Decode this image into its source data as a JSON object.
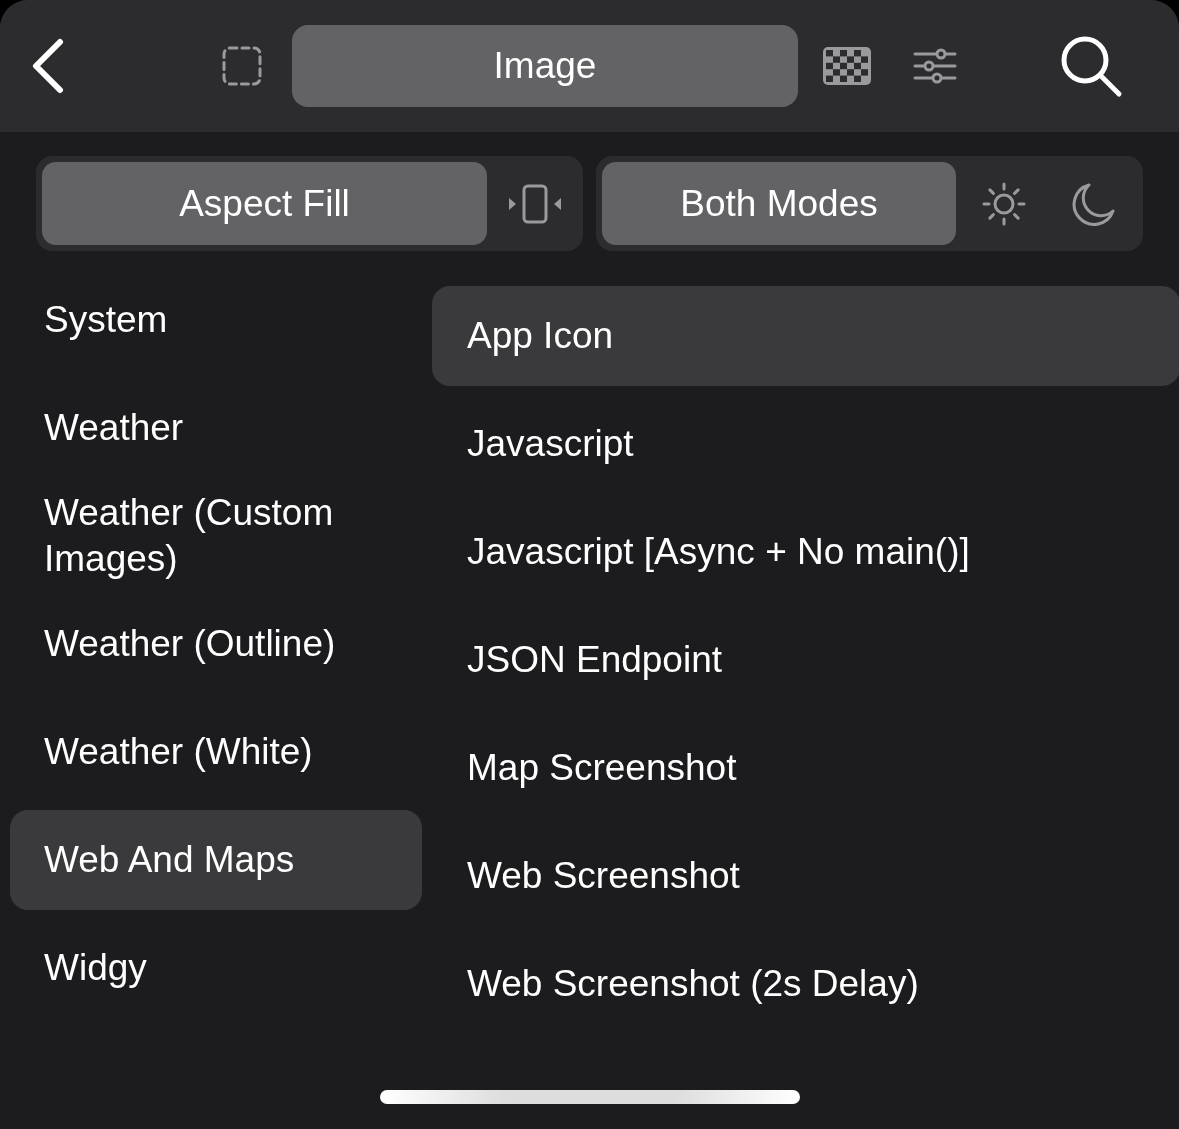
{
  "top_bar": {
    "title": "Image"
  },
  "segments": [
    {
      "label": "Aspect Fill",
      "selected": true
    },
    {
      "label": "Both Modes",
      "selected": true
    }
  ],
  "categories": [
    {
      "label": "System",
      "selected": false
    },
    {
      "label": "Weather",
      "selected": false
    },
    {
      "label": "Weather (Custom Images)",
      "selected": false
    },
    {
      "label": "Weather (Outline)",
      "selected": false
    },
    {
      "label": "Weather (White)",
      "selected": false
    },
    {
      "label": "Web And Maps",
      "selected": true
    },
    {
      "label": "Widgy",
      "selected": false
    }
  ],
  "templates": [
    {
      "label": "App Icon",
      "selected": true
    },
    {
      "label": "Javascript",
      "selected": false
    },
    {
      "label": "Javascript [Async + No main()]",
      "selected": false
    },
    {
      "label": "JSON Endpoint",
      "selected": false
    },
    {
      "label": "Map Screenshot",
      "selected": false
    },
    {
      "label": "Web Screenshot",
      "selected": false
    },
    {
      "label": "Web Screenshot (2s Delay)",
      "selected": false
    }
  ]
}
